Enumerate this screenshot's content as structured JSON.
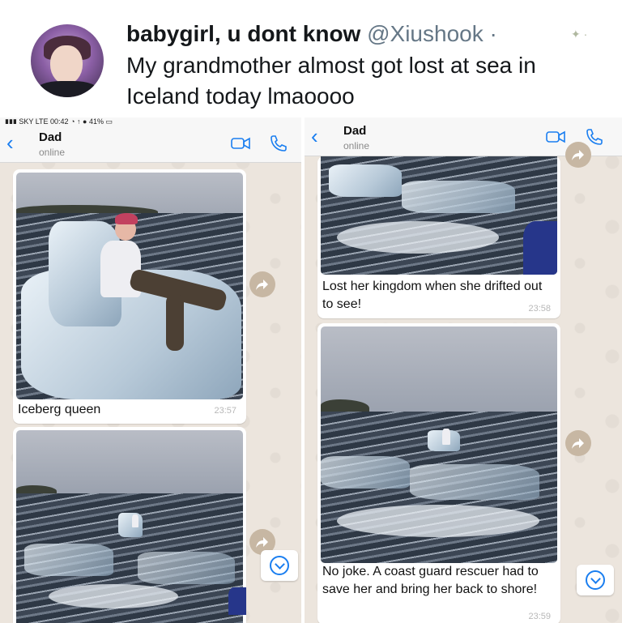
{
  "tweet": {
    "name": "babygirl, u dont know",
    "handle": "@Xiushook",
    "separator": "·",
    "text": "My grandmother almost got lost at sea in Iceland today lmaoooo"
  },
  "left_phone": {
    "status_bar": "▮▮▮ SKY  LTE                                  00:42                       ◔ ↑ ● 41% ▭",
    "contact": {
      "name": "Dad",
      "status": "online"
    },
    "messages": [
      {
        "caption": "Iceberg queen",
        "time": "23:57"
      }
    ]
  },
  "right_phone": {
    "contact": {
      "name": "Dad",
      "status": "online"
    },
    "messages": [
      {
        "caption": "Lost her kingdom when she drifted out to see!",
        "time": "23:58"
      },
      {
        "caption": "No joke. A coast guard rescuer had to save her and bring her back to shore!",
        "time": "23:59"
      }
    ]
  },
  "icons": {
    "back": "chevron-left-icon",
    "video": "video-camera-icon",
    "call": "phone-icon",
    "forward": "forward-arrow-icon",
    "scroll": "scroll-down-icon"
  },
  "colors": {
    "accent": "#1a7ef0",
    "chat_background": "#ece5dd",
    "bubble": "#ffffff",
    "timestamp": "#b8b8b8"
  }
}
